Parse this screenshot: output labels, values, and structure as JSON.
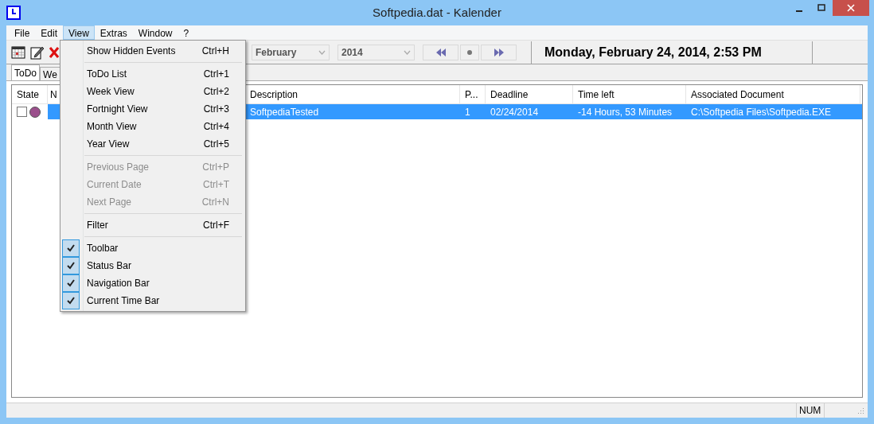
{
  "window": {
    "title": "Softpedia.dat - Kalender"
  },
  "menu_bar": [
    {
      "label": "File",
      "selected": false
    },
    {
      "label": "Edit",
      "selected": false
    },
    {
      "label": "View",
      "selected": true
    },
    {
      "label": "Extras",
      "selected": false
    },
    {
      "label": "Window",
      "selected": false
    },
    {
      "label": "?",
      "selected": false
    }
  ],
  "view_menu": [
    {
      "kind": "item",
      "label": "Show Hidden Events",
      "shortcut": "Ctrl+H",
      "disabled": false
    },
    {
      "kind": "separator"
    },
    {
      "kind": "item",
      "label": "ToDo List",
      "shortcut": "Ctrl+1",
      "disabled": false
    },
    {
      "kind": "item",
      "label": "Week View",
      "shortcut": "Ctrl+2",
      "disabled": false
    },
    {
      "kind": "item",
      "label": "Fortnight View",
      "shortcut": "Ctrl+3",
      "disabled": false
    },
    {
      "kind": "item",
      "label": "Month View",
      "shortcut": "Ctrl+4",
      "disabled": false
    },
    {
      "kind": "item",
      "label": "Year View",
      "shortcut": "Ctrl+5",
      "disabled": false
    },
    {
      "kind": "separator"
    },
    {
      "kind": "item",
      "label": "Previous Page",
      "shortcut": "Ctrl+P",
      "disabled": true
    },
    {
      "kind": "item",
      "label": "Current Date",
      "shortcut": "Ctrl+T",
      "disabled": true
    },
    {
      "kind": "item",
      "label": "Next Page",
      "shortcut": "Ctrl+N",
      "disabled": true
    },
    {
      "kind": "separator"
    },
    {
      "kind": "item",
      "label": "Filter",
      "shortcut": "Ctrl+F",
      "disabled": false
    },
    {
      "kind": "separator"
    },
    {
      "kind": "check",
      "label": "Toolbar",
      "checked": true
    },
    {
      "kind": "check",
      "label": "Status Bar",
      "checked": true
    },
    {
      "kind": "check",
      "label": "Navigation Bar",
      "checked": true
    },
    {
      "kind": "check",
      "label": "Current Time Bar",
      "checked": true
    }
  ],
  "toolbar": {
    "month": "February",
    "year": "2014",
    "current_time": "Monday, February 24, 2014, 2:53 PM"
  },
  "tabs": [
    {
      "label": "ToDo",
      "selected": true
    },
    {
      "label": "We",
      "selected": false
    }
  ],
  "table": {
    "columns": [
      "State",
      "N",
      "Description",
      "P...",
      "Deadline",
      "Time left",
      "Associated Document"
    ],
    "rows": [
      {
        "checked": false,
        "color": "#9b4f8c",
        "selected": true,
        "description": "SoftpediaTested",
        "priority": "1",
        "deadline": "02/24/2014",
        "time_left": "-14 Hours, 53 Minutes",
        "document": "C:\\Softpedia Files\\Softpedia.EXE"
      }
    ]
  },
  "status_bar": {
    "indicator": "NUM"
  }
}
